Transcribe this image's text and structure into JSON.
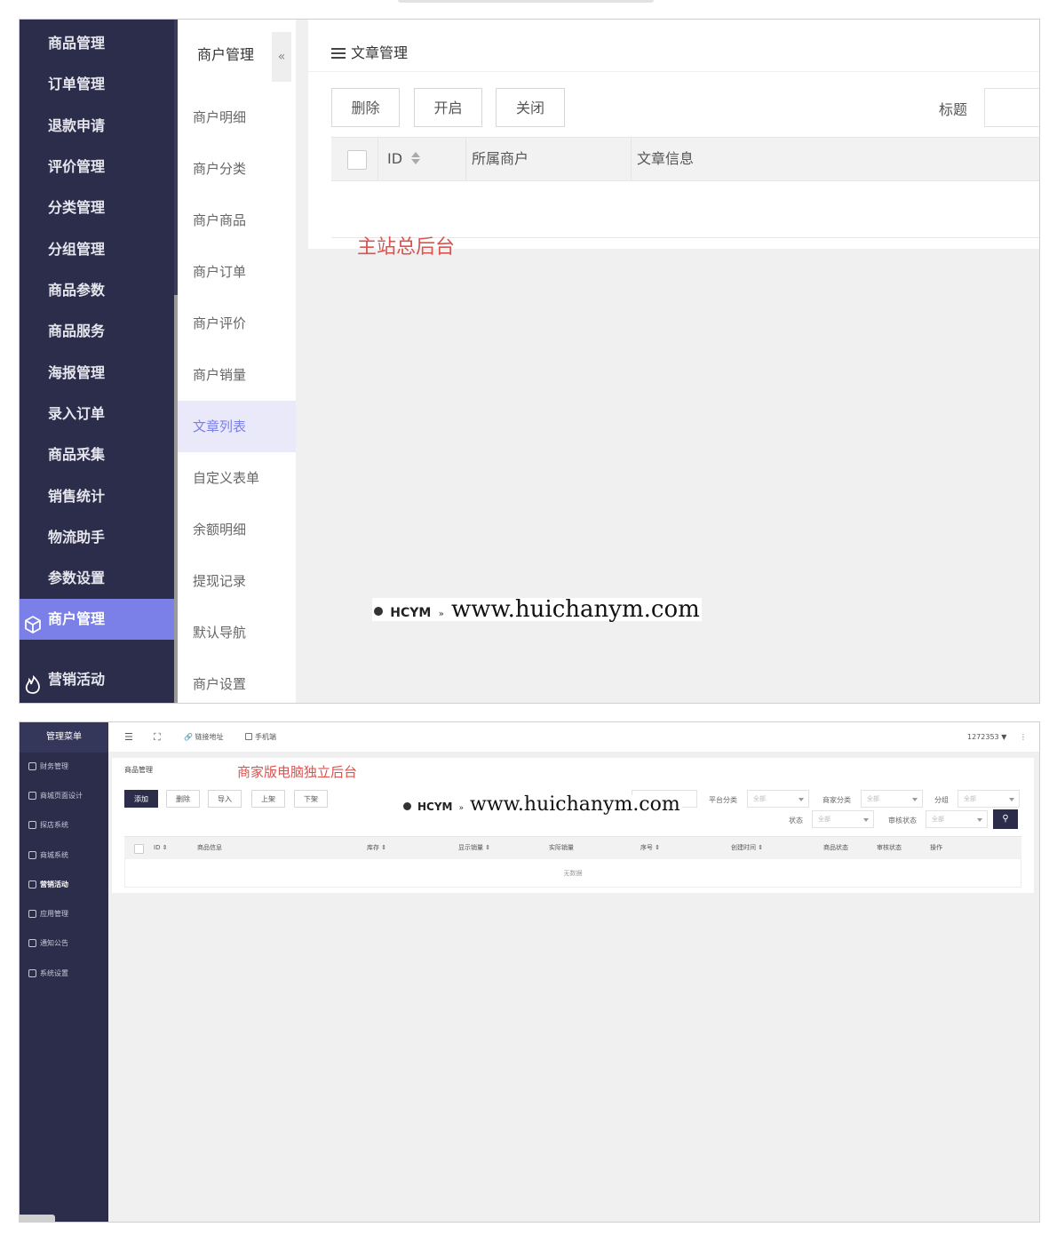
{
  "panel1": {
    "sidebar": {
      "items": [
        {
          "label": "商品管理"
        },
        {
          "label": "订单管理"
        },
        {
          "label": "退款申请"
        },
        {
          "label": "评价管理"
        },
        {
          "label": "分类管理"
        },
        {
          "label": "分组管理"
        },
        {
          "label": "商品参数"
        },
        {
          "label": "商品服务"
        },
        {
          "label": "海报管理"
        },
        {
          "label": "录入订单"
        },
        {
          "label": "商品采集"
        },
        {
          "label": "销售统计"
        },
        {
          "label": "物流助手"
        },
        {
          "label": "参数设置"
        },
        {
          "label": "商户管理",
          "icon": "cube-icon",
          "active": true
        },
        {
          "label": "营销活动",
          "icon": "flame-icon"
        }
      ]
    },
    "submenu": {
      "title": "商户管理",
      "collapse_icon": "«",
      "items": [
        {
          "label": "商户明细"
        },
        {
          "label": "商户分类"
        },
        {
          "label": "商户商品"
        },
        {
          "label": "商户订单"
        },
        {
          "label": "商户评价"
        },
        {
          "label": "商户销量"
        },
        {
          "label": "文章列表",
          "active": true
        },
        {
          "label": "自定义表单"
        },
        {
          "label": "余额明细"
        },
        {
          "label": "提现记录"
        },
        {
          "label": "默认导航"
        },
        {
          "label": "商户设置"
        }
      ]
    },
    "main": {
      "title": "文章管理",
      "buttons": {
        "delete": "删除",
        "open": "开启",
        "close": "关闭"
      },
      "filter_label": "标题",
      "columns": {
        "id": "ID",
        "merchant": "所属商户",
        "info": "文章信息"
      },
      "annotation": "主站总后台"
    },
    "watermark": {
      "logo": "HCYM",
      "url": "www.huichanym.com"
    }
  },
  "panel2": {
    "sidebar": {
      "title": "管理菜单",
      "items": [
        {
          "label": "财务管理"
        },
        {
          "label": "商城页面设计"
        },
        {
          "label": "探店系统"
        },
        {
          "label": "商城系统"
        },
        {
          "label": "营销活动",
          "active": true
        },
        {
          "label": "应用管理"
        },
        {
          "label": "通知公告"
        },
        {
          "label": "系统设置"
        }
      ]
    },
    "topbar": {
      "menu_icon": "☰",
      "fullscreen_icon": "⛶",
      "link_label": "链接地址",
      "mobile_label": "手机端",
      "user": "1272353",
      "more_icon": "⋮"
    },
    "content": {
      "breadcrumb": "商品管理",
      "annotation": "商家版电脑独立后台",
      "buttons": {
        "add": "添加",
        "delete": "删除",
        "import": "导入",
        "shelve": "上架",
        "unshelve": "下架"
      },
      "filters": {
        "platform_category": "平台分类",
        "merchant_category": "商家分类",
        "group": "分组",
        "status": "状态",
        "audit_status": "审核状态",
        "all_option": "全部"
      },
      "search_icon": "⚲",
      "columns": [
        "ID",
        "商品信息",
        "库存",
        "显示销量",
        "实际销量",
        "序号",
        "创建时间",
        "商品状态",
        "审核状态",
        "操作"
      ],
      "empty_text": "无数据"
    },
    "watermark": {
      "logo": "HCYM",
      "url": "www.huichanym.com"
    }
  }
}
